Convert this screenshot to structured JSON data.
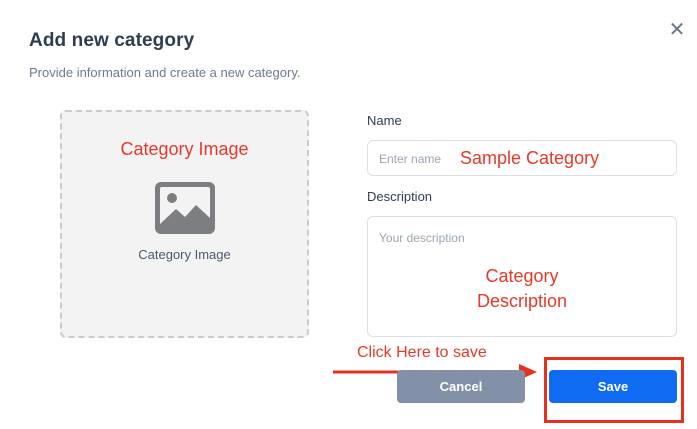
{
  "dialog": {
    "title": "Add new category",
    "subtitle": "Provide information and create a new category.",
    "close_icon": "close-icon"
  },
  "image_upload": {
    "annotation": "Category Image",
    "icon": "image-icon",
    "label": "Category Image"
  },
  "form": {
    "name_label": "Name",
    "name_placeholder": "Enter name",
    "name_annotation": "Sample Category",
    "description_label": "Description",
    "description_placeholder": "Your description",
    "description_annotation_line1": "Category",
    "description_annotation_line2": "Description"
  },
  "actions": {
    "cancel_label": "Cancel",
    "save_label": "Save"
  },
  "annotations": {
    "click_hint": "Click Here to save"
  },
  "colors": {
    "annotation_red": "#e8382b",
    "primary_blue": "#0f6cf2",
    "cancel_gray": "#8391a8"
  }
}
